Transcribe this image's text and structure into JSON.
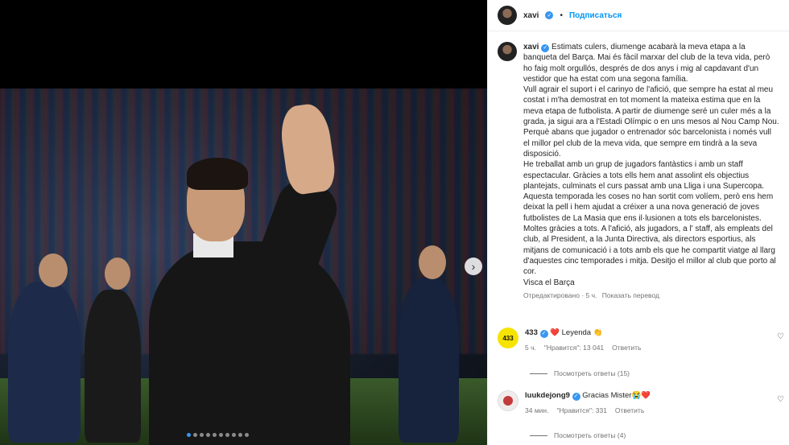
{
  "header": {
    "username": "xavi",
    "separator": "•",
    "follow_label": "Подписаться"
  },
  "caption": {
    "username": "xavi",
    "text": "Estimats culers, diumenge acabarà la meva etapa a la banqueta del Barça. Mai és fàcil marxar del club de la teva vida, però ho faig molt orgullós, després de dos anys i mig al capdavant d'un vestidor que ha estat com una segona família.\nVull agrair el suport i el carinyo de l'afició, que sempre ha estat al meu costat i m'ha demostrat en tot moment la mateixa estima que en la meva etapa de futbolista. A partir de diumenge seré un culer més a la grada, ja sigui ara a l'Estadi Olímpic o en uns mesos al Nou Camp Nou. Perquè abans que jugador o entrenador sóc barcelonista i només vull el millor pel club de la meva vida, que sempre em tindrà a la seva disposició.\nHe treballat amb un grup de jugadors fantàstics i amb un staff espectacular. Gràcies a tots ells hem anat assolint els objectius plantejats, culminats el curs passat amb una Lliga i una Supercopa. Aquesta temporada les coses no han sortit com volíem, però ens hem deixat la pell i hem ajudat a créixer a una nova generació de joves futbolistes de La Masia que ens il·lusionen a tots els barcelonistes.\nMoltes gràcies a tots. A l'afició, als jugadors, a l' staff, als empleats del club, al President, a la Junta Directiva, als directors esportius, als mitjans de comunicació i a tots amb els que he compartit viatge al llarg d'aquestes cinc temporades i mitja. Desitjo el millor al club que porto al cor.\nVisca el Barça",
    "edited": "Отредактировано",
    "time": "5 ч.",
    "translate": "Показать перевод"
  },
  "comments": [
    {
      "username": "433",
      "text": "Leyenda 👏",
      "heart_emoji": "❤️",
      "time": "5 ч.",
      "likes": "\"Нравится\": 13 041",
      "reply": "Ответить",
      "view_replies": "Посмотреть ответы (15)",
      "avatar_glyph": "433"
    },
    {
      "username": "luukdejong9",
      "text": "Gracias Mister😭❤️",
      "time": "34 мин.",
      "likes": "\"Нравится\": 331",
      "reply": "Ответить",
      "view_replies": "Посмотреть ответы (4)",
      "avatar_glyph": ""
    }
  ],
  "media": {
    "slide_count": 10,
    "active_slide": 1
  },
  "colors": {
    "accent": "#0095f6",
    "verified": "#3897f0",
    "muted": "#737373"
  }
}
